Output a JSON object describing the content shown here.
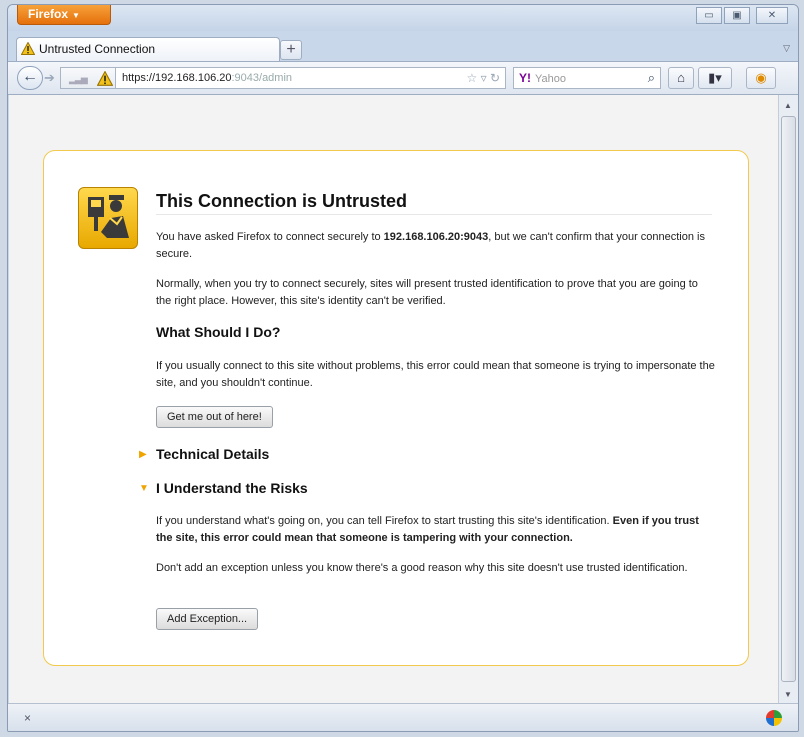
{
  "window": {
    "app_menu_label": "Firefox",
    "tab_title": "Untrusted Connection",
    "new_tab_label": "+",
    "controls": {
      "minimize": "▭",
      "maximize": "▣",
      "close": "✕"
    }
  },
  "navbar": {
    "url_host": "https://192.168.106.20",
    "url_rest": ":9043/admin",
    "search_engine_logo": "Y!",
    "search_placeholder": "Yahoo"
  },
  "page": {
    "title": "This Connection is Untrusted",
    "intro_prefix": "You have asked Firefox to connect securely to ",
    "intro_host": "192.168.106.20:9043",
    "intro_suffix": ", but we can't confirm that your connection is secure.",
    "normally": "Normally, when you try to connect securely, sites will present trusted identification to prove that you are going to the right place. However, this site's identity can't be verified.",
    "what_heading": "What Should I Do?",
    "what_text": "If you usually connect to this site without problems, this error could mean that someone is trying to impersonate the site, and you shouldn't continue.",
    "get_out_label": "Get me out of here!",
    "technical_details": "Technical Details",
    "risks_heading": "I Understand the Risks",
    "risks_text_prefix": "If you understand what's going on, you can tell Firefox to start trusting this site's identification. ",
    "risks_text_bold": "Even if you trust the site, this error could mean that someone is tampering with your connection.",
    "dont_add": "Don't add an exception unless you know there's a good reason why this site doesn't use trusted identification.",
    "add_exception_label": "Add Exception..."
  },
  "statusbar": {
    "close_glyph": "×"
  },
  "colors": {
    "firefox_orange": "#e5700b",
    "warning_yellow": "#f0a400",
    "card_border": "#f2c94c"
  },
  "icons": [
    "warning-icon",
    "back-arrow-icon",
    "forward-arrow-icon",
    "bookmark-star-icon",
    "reload-icon",
    "magnifier-icon",
    "home-icon",
    "bookmarks-icon",
    "addon-icon",
    "policeman-icon"
  ]
}
